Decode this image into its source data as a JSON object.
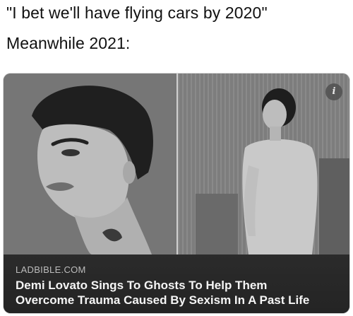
{
  "caption": {
    "line1": "\"I bet we'll have flying cars by 2020\"",
    "line2": "Meanwhile 2021:"
  },
  "card": {
    "info_label": "i",
    "source": "LADBIBLE.COM",
    "headline_line1": "Demi Lovato Sings To Ghosts To Help Them",
    "headline_line2": "Overcome Trauma Caused By Sexism In A Past Life"
  },
  "colors": {
    "caption_text": "#111111",
    "card_footer": "#2b2b2b",
    "source_text": "#bdbdbd",
    "headline_text": "#f5f5f5"
  }
}
